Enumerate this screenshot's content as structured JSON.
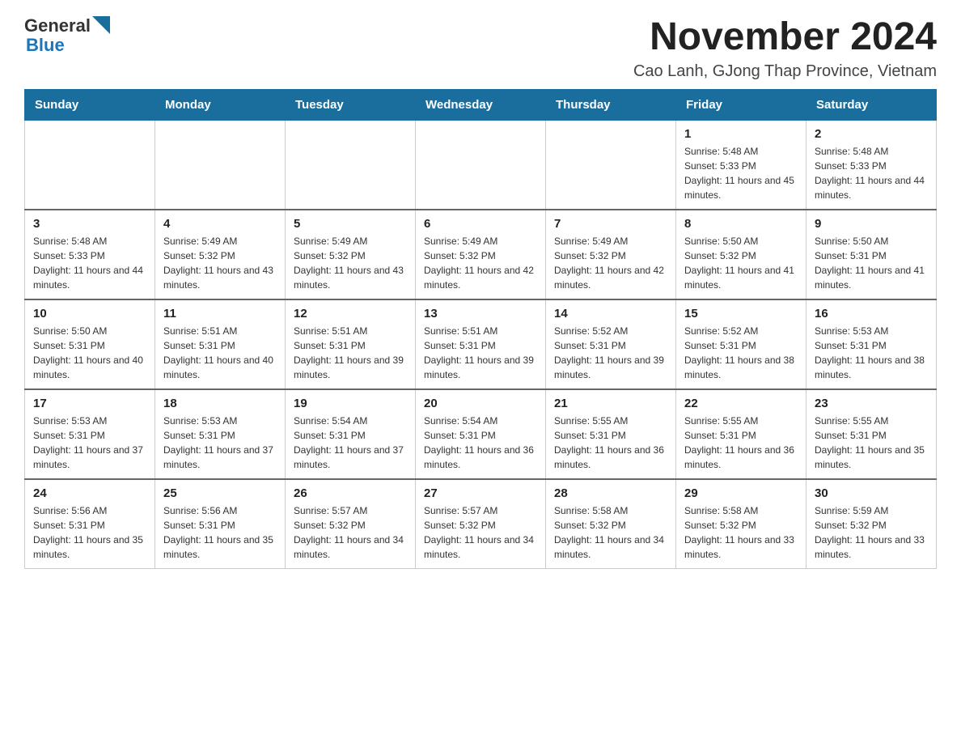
{
  "logo": {
    "text_general": "General",
    "text_blue": "Blue"
  },
  "page_title": "November 2024",
  "subtitle": "Cao Lanh, GJong Thap Province, Vietnam",
  "days_of_week": [
    "Sunday",
    "Monday",
    "Tuesday",
    "Wednesday",
    "Thursday",
    "Friday",
    "Saturday"
  ],
  "weeks": [
    [
      {
        "day": "",
        "info": ""
      },
      {
        "day": "",
        "info": ""
      },
      {
        "day": "",
        "info": ""
      },
      {
        "day": "",
        "info": ""
      },
      {
        "day": "",
        "info": ""
      },
      {
        "day": "1",
        "info": "Sunrise: 5:48 AM\nSunset: 5:33 PM\nDaylight: 11 hours and 45 minutes."
      },
      {
        "day": "2",
        "info": "Sunrise: 5:48 AM\nSunset: 5:33 PM\nDaylight: 11 hours and 44 minutes."
      }
    ],
    [
      {
        "day": "3",
        "info": "Sunrise: 5:48 AM\nSunset: 5:33 PM\nDaylight: 11 hours and 44 minutes."
      },
      {
        "day": "4",
        "info": "Sunrise: 5:49 AM\nSunset: 5:32 PM\nDaylight: 11 hours and 43 minutes."
      },
      {
        "day": "5",
        "info": "Sunrise: 5:49 AM\nSunset: 5:32 PM\nDaylight: 11 hours and 43 minutes."
      },
      {
        "day": "6",
        "info": "Sunrise: 5:49 AM\nSunset: 5:32 PM\nDaylight: 11 hours and 42 minutes."
      },
      {
        "day": "7",
        "info": "Sunrise: 5:49 AM\nSunset: 5:32 PM\nDaylight: 11 hours and 42 minutes."
      },
      {
        "day": "8",
        "info": "Sunrise: 5:50 AM\nSunset: 5:32 PM\nDaylight: 11 hours and 41 minutes."
      },
      {
        "day": "9",
        "info": "Sunrise: 5:50 AM\nSunset: 5:31 PM\nDaylight: 11 hours and 41 minutes."
      }
    ],
    [
      {
        "day": "10",
        "info": "Sunrise: 5:50 AM\nSunset: 5:31 PM\nDaylight: 11 hours and 40 minutes."
      },
      {
        "day": "11",
        "info": "Sunrise: 5:51 AM\nSunset: 5:31 PM\nDaylight: 11 hours and 40 minutes."
      },
      {
        "day": "12",
        "info": "Sunrise: 5:51 AM\nSunset: 5:31 PM\nDaylight: 11 hours and 39 minutes."
      },
      {
        "day": "13",
        "info": "Sunrise: 5:51 AM\nSunset: 5:31 PM\nDaylight: 11 hours and 39 minutes."
      },
      {
        "day": "14",
        "info": "Sunrise: 5:52 AM\nSunset: 5:31 PM\nDaylight: 11 hours and 39 minutes."
      },
      {
        "day": "15",
        "info": "Sunrise: 5:52 AM\nSunset: 5:31 PM\nDaylight: 11 hours and 38 minutes."
      },
      {
        "day": "16",
        "info": "Sunrise: 5:53 AM\nSunset: 5:31 PM\nDaylight: 11 hours and 38 minutes."
      }
    ],
    [
      {
        "day": "17",
        "info": "Sunrise: 5:53 AM\nSunset: 5:31 PM\nDaylight: 11 hours and 37 minutes."
      },
      {
        "day": "18",
        "info": "Sunrise: 5:53 AM\nSunset: 5:31 PM\nDaylight: 11 hours and 37 minutes."
      },
      {
        "day": "19",
        "info": "Sunrise: 5:54 AM\nSunset: 5:31 PM\nDaylight: 11 hours and 37 minutes."
      },
      {
        "day": "20",
        "info": "Sunrise: 5:54 AM\nSunset: 5:31 PM\nDaylight: 11 hours and 36 minutes."
      },
      {
        "day": "21",
        "info": "Sunrise: 5:55 AM\nSunset: 5:31 PM\nDaylight: 11 hours and 36 minutes."
      },
      {
        "day": "22",
        "info": "Sunrise: 5:55 AM\nSunset: 5:31 PM\nDaylight: 11 hours and 36 minutes."
      },
      {
        "day": "23",
        "info": "Sunrise: 5:55 AM\nSunset: 5:31 PM\nDaylight: 11 hours and 35 minutes."
      }
    ],
    [
      {
        "day": "24",
        "info": "Sunrise: 5:56 AM\nSunset: 5:31 PM\nDaylight: 11 hours and 35 minutes."
      },
      {
        "day": "25",
        "info": "Sunrise: 5:56 AM\nSunset: 5:31 PM\nDaylight: 11 hours and 35 minutes."
      },
      {
        "day": "26",
        "info": "Sunrise: 5:57 AM\nSunset: 5:32 PM\nDaylight: 11 hours and 34 minutes."
      },
      {
        "day": "27",
        "info": "Sunrise: 5:57 AM\nSunset: 5:32 PM\nDaylight: 11 hours and 34 minutes."
      },
      {
        "day": "28",
        "info": "Sunrise: 5:58 AM\nSunset: 5:32 PM\nDaylight: 11 hours and 34 minutes."
      },
      {
        "day": "29",
        "info": "Sunrise: 5:58 AM\nSunset: 5:32 PM\nDaylight: 11 hours and 33 minutes."
      },
      {
        "day": "30",
        "info": "Sunrise: 5:59 AM\nSunset: 5:32 PM\nDaylight: 11 hours and 33 minutes."
      }
    ]
  ]
}
